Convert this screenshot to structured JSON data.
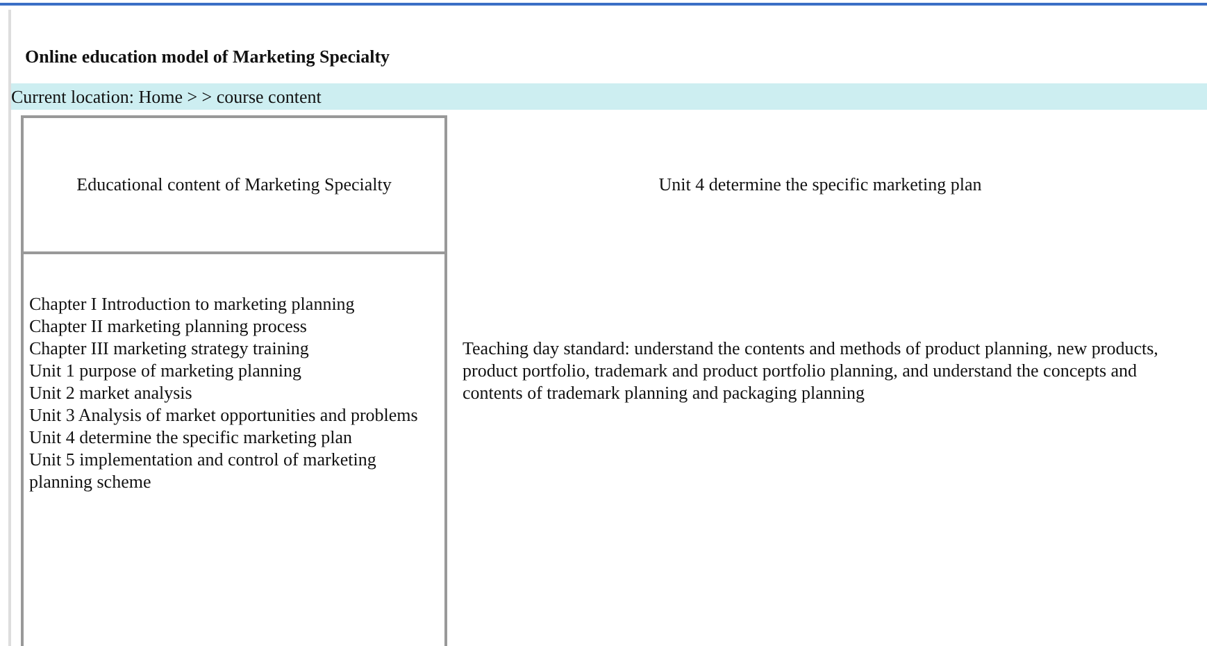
{
  "page_title": "Online education model of Marketing Specialty",
  "breadcrumb": "Current location: Home > > course content",
  "sidebar": {
    "heading": "Educational content of Marketing Specialty",
    "items": [
      "Chapter I Introduction to marketing planning",
      "Chapter II marketing planning process",
      "Chapter III marketing strategy training",
      "Unit 1 purpose of marketing planning",
      "Unit 2 market analysis",
      "Unit 3 Analysis of market opportunities and problems",
      "Unit 4 determine the specific marketing plan",
      "Unit 5 implementation and control of marketing planning scheme"
    ]
  },
  "content": {
    "heading": "Unit 4 determine the specific marketing plan",
    "body": "Teaching day standard: understand the contents and methods of product planning, new products, product portfolio, trademark and product portfolio planning, and understand the concepts and contents of trademark planning and packaging planning"
  }
}
